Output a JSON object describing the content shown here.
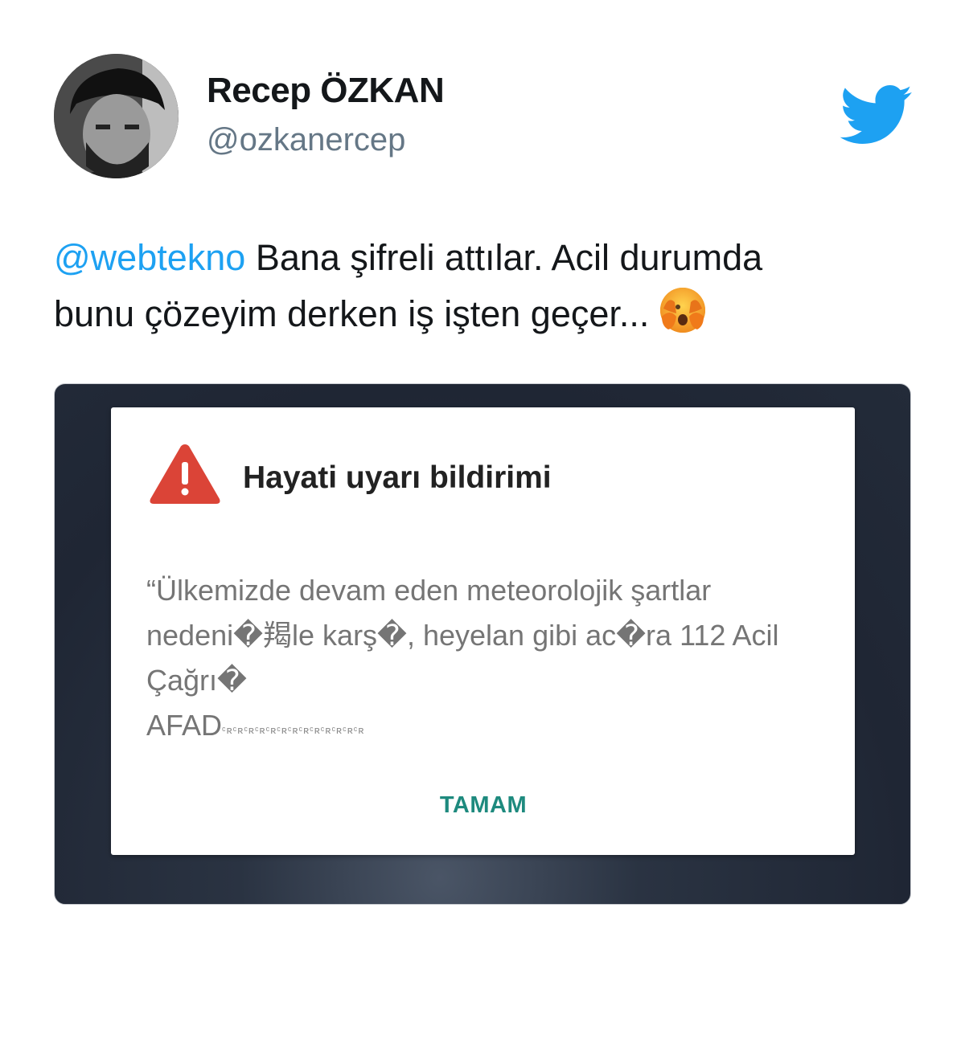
{
  "tweet": {
    "author_name": "Recep ÖZKAN",
    "author_handle": "@ozkanercep",
    "mention": "@webtekno",
    "text_part1": " Bana şifreli attılar. Acil durumda",
    "text_part2": "bunu çözeyim derken iş işten geçer..."
  },
  "icons": {
    "avatar": "profile-photo",
    "logo": "twitter-bird-icon",
    "emoji": "face-with-hand-over-mouth-emoji",
    "alert": "warning-triangle-icon"
  },
  "colors": {
    "mention": "#1da1f2",
    "twitter_blue": "#1da1f2",
    "handle_gray": "#657786",
    "alert_red": "#db4437",
    "button_teal": "#1e8a7e",
    "screen_background": "#1f2634"
  },
  "alert_dialog": {
    "title": "Hayati uyarı bildirimi",
    "body_line1": "“Ülkemizde devam eden meteorolojik şartlar",
    "body_line2": "nedeni�羯le karş�, heyelan gibi ac�ra 112 Acil",
    "body_line3": "Çağrı�",
    "body_line4": "AFAD",
    "body_line4_tail": "ᶜʀᶜʀᶜʀᶜʀᶜʀᶜʀᶜʀᶜʀᶜʀᶜʀᶜʀᶜʀᶜʀ",
    "ok_button": "TAMAM"
  }
}
